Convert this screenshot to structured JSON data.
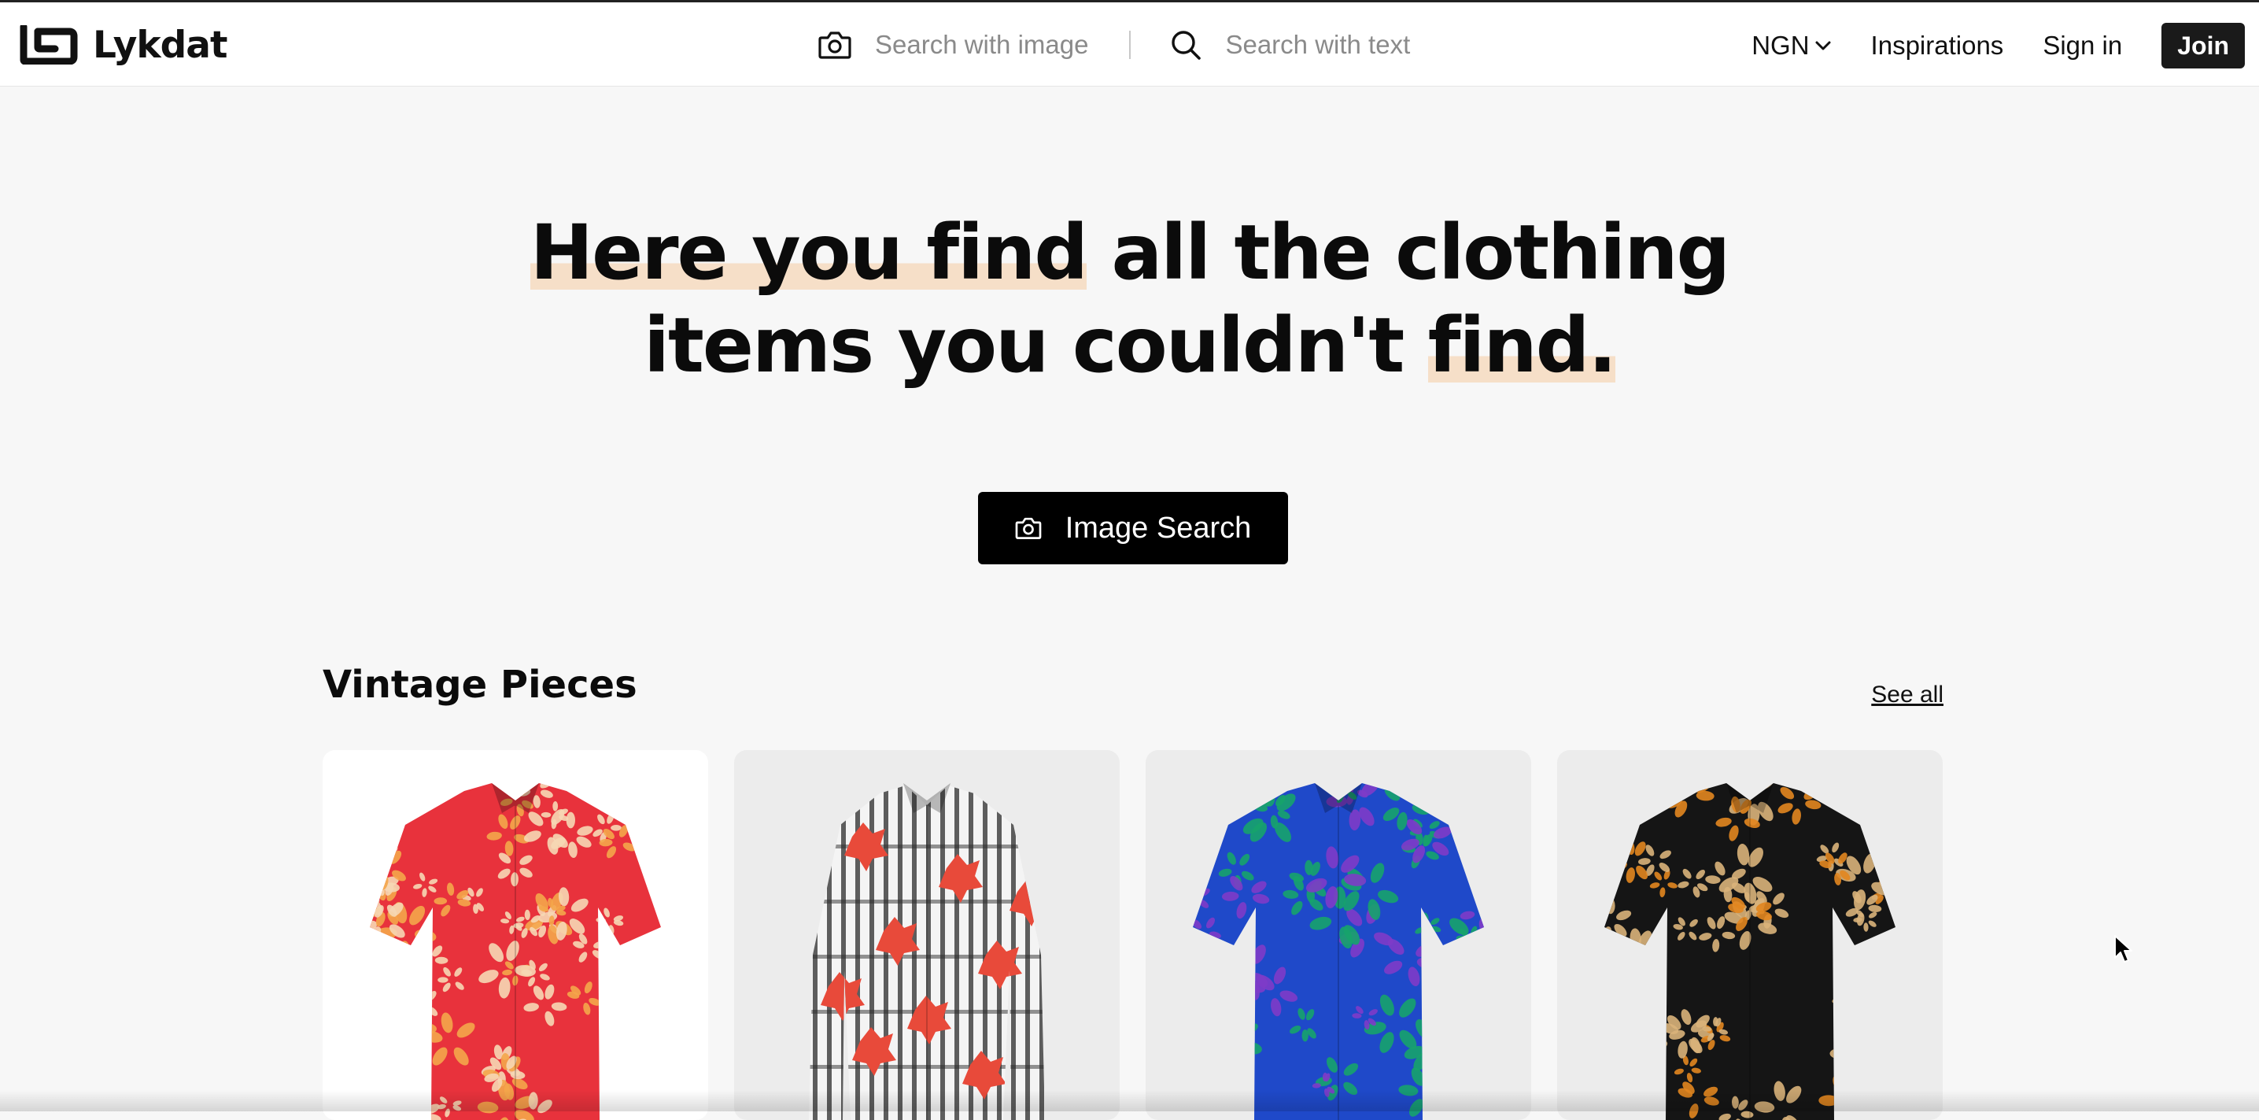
{
  "header": {
    "logo_text": "Lykdat",
    "search_image_placeholder": "Search with image",
    "search_text_placeholder": "Search with text",
    "currency": "NGN",
    "nav_inspirations": "Inspirations",
    "nav_sign_in": "Sign in",
    "join_label": "Join"
  },
  "hero": {
    "heading_part1": "Here you find",
    "heading_part2": " all the clothing",
    "heading_part3": "items you couldn't ",
    "heading_part4": "find.",
    "cta_label": "Image Search"
  },
  "section": {
    "title": "Vintage Pieces",
    "see_all": "See all",
    "products": [
      {
        "name": "red-floral-shirt",
        "bg": "#ffffff",
        "colors": [
          "#e8323c",
          "#f6d7b4",
          "#f4a64a"
        ]
      },
      {
        "name": "striped-red-shirt",
        "bg": "#ececec",
        "colors": [
          "#f4f4f4",
          "#2b2b2b",
          "#e84a3a"
        ]
      },
      {
        "name": "blue-tropical-shirt",
        "bg": "#ececec",
        "colors": [
          "#1f49c9",
          "#16a36b",
          "#7e3bc8"
        ]
      },
      {
        "name": "black-tropical-shirt",
        "bg": "#ececec",
        "colors": [
          "#151515",
          "#d9b37a",
          "#e2861f"
        ]
      }
    ]
  },
  "colors": {
    "background": "#f7f7f7",
    "highlight": "#f6dfc8",
    "button": "#000000"
  }
}
